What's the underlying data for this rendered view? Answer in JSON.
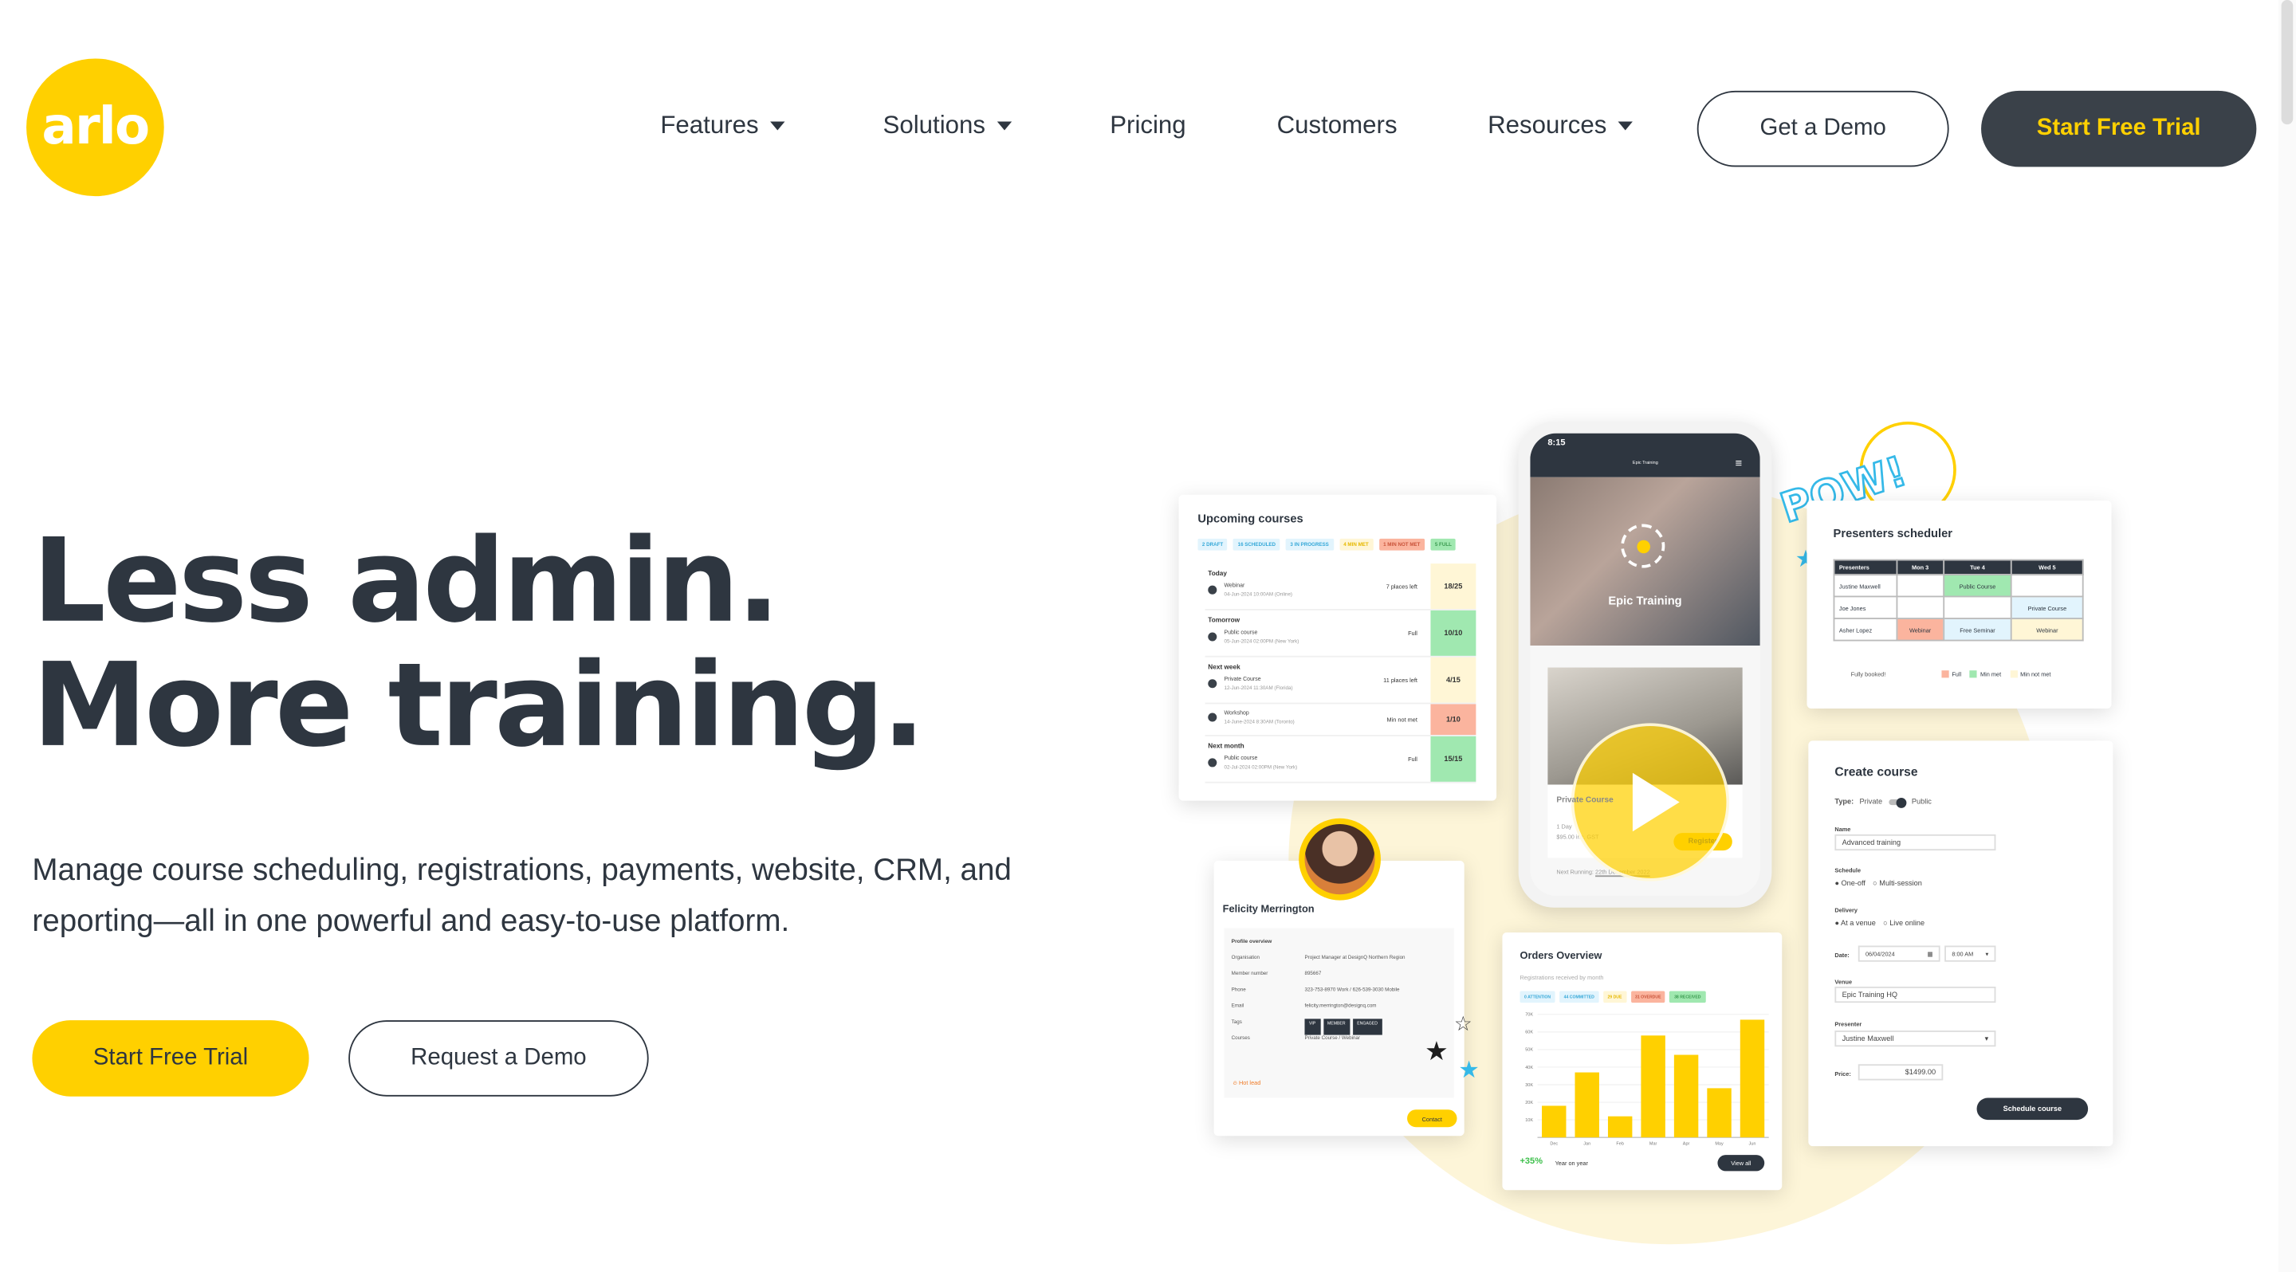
{
  "logo": {
    "text": "arlo",
    "color": "#ffd000"
  },
  "nav": {
    "items": [
      {
        "label": "Features",
        "dropdown": true
      },
      {
        "label": "Solutions",
        "dropdown": true
      },
      {
        "label": "Pricing",
        "dropdown": false
      },
      {
        "label": "Customers",
        "dropdown": false
      },
      {
        "label": "Resources",
        "dropdown": true
      }
    ],
    "get_demo": "Get a Demo",
    "start_trial": "Start Free Trial"
  },
  "hero": {
    "line1": "Less admin.",
    "line2": "More training.",
    "paragraph": "Manage course scheduling, registrations, payments, website, CRM, and reporting—all in one powerful and easy-to-use platform.",
    "cta_primary": "Start Free Trial",
    "cta_secondary": "Request a Demo"
  },
  "colors": {
    "brand_yellow": "#ffd000",
    "dark": "#2e3640",
    "green": "#a0e8b0",
    "red": "#fbb49e",
    "cream": "#fff6d6",
    "blue": "#e2f4fd"
  },
  "upcoming": {
    "title": "Upcoming courses",
    "chips": [
      {
        "label": "2 DRAFT",
        "kind": "blue"
      },
      {
        "label": "16 SCHEDULED",
        "kind": "blue"
      },
      {
        "label": "3 IN PROGRESS",
        "kind": "blue"
      },
      {
        "label": "4 MIN MET",
        "kind": "cream"
      },
      {
        "label": "1 MIN NOT MET",
        "kind": "red"
      },
      {
        "label": "5 FULL",
        "kind": "green"
      }
    ],
    "rows": [
      {
        "group": "Today",
        "name": "Webinar",
        "when": "04-Jun-2024 10:00AM (Online)",
        "status": "7 places left",
        "count": "18/25",
        "kind": "cream"
      },
      {
        "group": "Tomorrow",
        "name": "Public course",
        "when": "05-Jun-2024 02:00PM (New York)",
        "status": "Full",
        "count": "10/10",
        "kind": "green"
      },
      {
        "group": "Next week",
        "name": "Private Course",
        "when": "12-Jun-2024 11:30AM (Florida)",
        "status": "11 places left",
        "count": "4/15",
        "kind": "cream"
      },
      {
        "group": "",
        "name": "Workshop",
        "when": "14-June-2024 8:30AM (Toronto)",
        "status": "Min not met",
        "count": "1/10",
        "kind": "red"
      },
      {
        "group": "Next month",
        "name": "Public course",
        "when": "02-Jul-2024 02:00PM (New York)",
        "status": "Full",
        "count": "15/15",
        "kind": "green"
      }
    ]
  },
  "phone": {
    "time": "8:15",
    "brand": "Epic Training",
    "hero_title": "Epic Training",
    "course": "Private Course",
    "duration": "1 Day",
    "price": "$95.00 inc. GST",
    "register": "Register",
    "next_running_label": "Next Running:",
    "next_running": "22th December 2022"
  },
  "pow": "POW!",
  "scheduler": {
    "title": "Presenters scheduler",
    "headers": [
      "Presenters",
      "Mon 3",
      "Tue 4",
      "Wed 5"
    ],
    "rows": [
      {
        "name": "Justine Maxwell",
        "cells": [
          {
            "t": "",
            "k": ""
          },
          {
            "t": "Public Course",
            "k": "green"
          },
          {
            "t": "",
            "k": ""
          }
        ]
      },
      {
        "name": "Joe Jones",
        "cells": [
          {
            "t": "",
            "k": ""
          },
          {
            "t": "",
            "k": ""
          },
          {
            "t": "Private Course",
            "k": "blue"
          }
        ]
      },
      {
        "name": "Asher Lopez",
        "cells": [
          {
            "t": "Webinar",
            "k": "red"
          },
          {
            "t": "Free Seminar",
            "k": "blue"
          },
          {
            "t": "Webinar",
            "k": "cream"
          }
        ]
      }
    ],
    "note": "Fully booked!",
    "legend": [
      {
        "label": "Full",
        "k": "red"
      },
      {
        "label": "Min met",
        "k": "green"
      },
      {
        "label": "Min not met",
        "k": "cream"
      }
    ]
  },
  "create": {
    "title": "Create course",
    "type_label": "Type:",
    "type_left": "Private",
    "type_right": "Public",
    "name_label": "Name",
    "name_value": "Advanced training",
    "schedule_label": "Schedule",
    "schedule_opts": [
      "One-off",
      "Multi-session"
    ],
    "delivery_label": "Delivery",
    "delivery_opts": [
      "At a venue",
      "Live online"
    ],
    "date_label": "Date:",
    "date_value": "06/04/2024",
    "time_value": "8:00 AM",
    "venue_label": "Venue",
    "venue_value": "Epic Training HQ",
    "presenter_label": "Presenter",
    "presenter_value": "Justine Maxwell",
    "price_label": "Price:",
    "price_value": "$1499.00",
    "submit": "Schedule course"
  },
  "profile": {
    "name": "Felicity Merrington",
    "section": "Profile overview",
    "fields": [
      {
        "k": "Organisation",
        "v": "Project Manager at DesignQ Northern Region"
      },
      {
        "k": "Member number",
        "v": "895667"
      },
      {
        "k": "Phone",
        "v": "323-753-8970 Work / 626-539-3030 Mobile"
      },
      {
        "k": "Email",
        "v": "felicity.merrington@designq.com"
      },
      {
        "k": "Tags",
        "v": ""
      },
      {
        "k": "Courses",
        "v": "Private Course / Webinar"
      }
    ],
    "tags": [
      "VIP",
      "MEMBER",
      "ENGAGED"
    ],
    "hot_lead": "Hot lead",
    "contact": "Contact"
  },
  "orders": {
    "title": "Orders Overview",
    "subtitle": "Registrations received by month",
    "chips": [
      {
        "label": "0 ATTENTION",
        "kind": "blue"
      },
      {
        "label": "44 COMMITTED",
        "kind": "blue"
      },
      {
        "label": "29 DUE",
        "kind": "cream"
      },
      {
        "label": "31 OVERDUE",
        "kind": "red"
      },
      {
        "label": "38 RECEIVED",
        "kind": "green"
      }
    ],
    "growth": "+35%",
    "growth_label": "Year on year",
    "view_all": "View all"
  },
  "chart_data": {
    "type": "bar",
    "categories": [
      "Dec",
      "Jan",
      "Feb",
      "Mar",
      "Apr",
      "May",
      "Jun"
    ],
    "values": [
      18,
      37,
      12,
      58,
      47,
      28,
      67
    ],
    "y_ticks": [
      "10K",
      "20K",
      "30K",
      "40K",
      "50K",
      "60K",
      "70K"
    ],
    "ylim": [
      0,
      70
    ],
    "grid": true,
    "color": "#ffd000"
  }
}
